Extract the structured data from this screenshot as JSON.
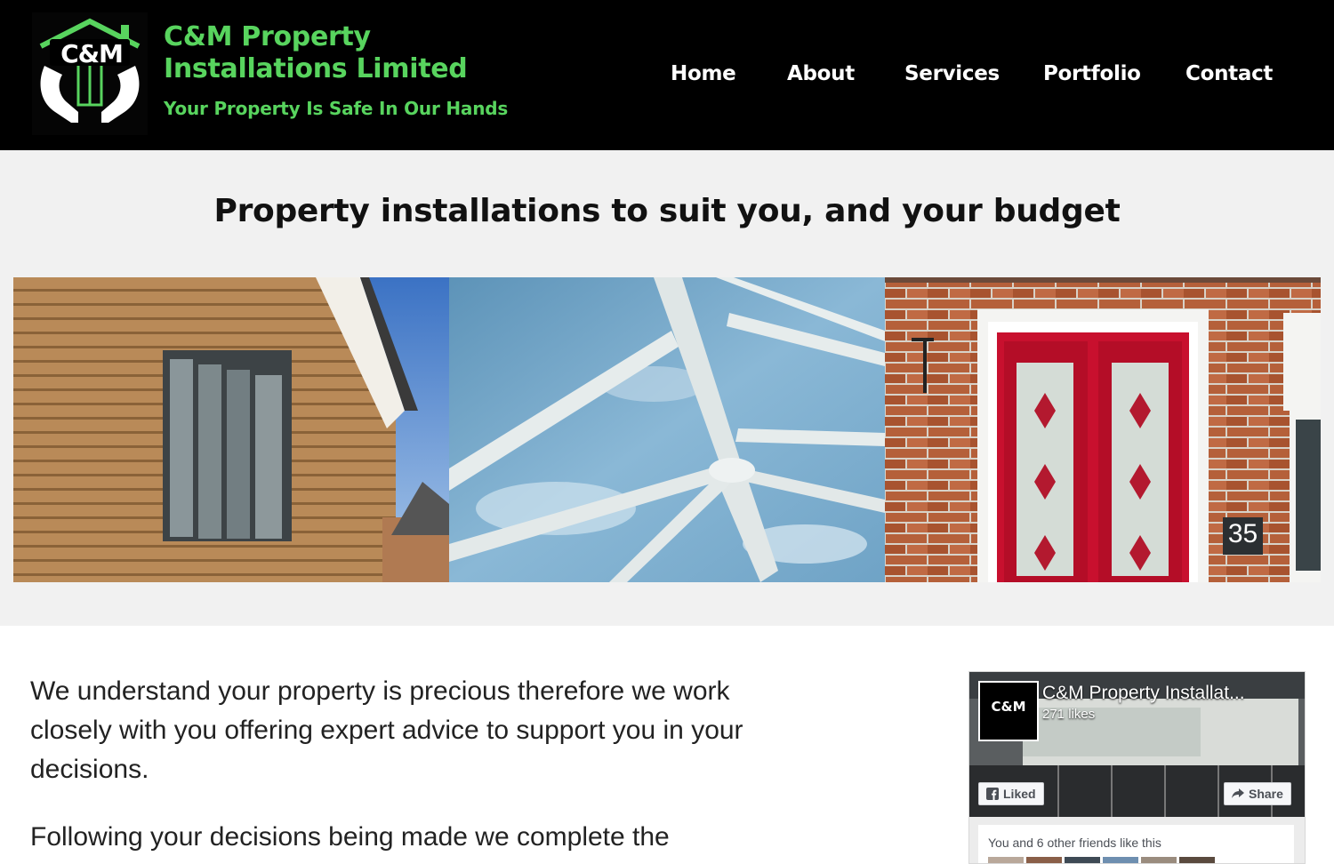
{
  "header": {
    "logo_text": "C&M",
    "brand_line1": "C&M Property",
    "brand_line2": "Installations Limited",
    "tagline": "Your Property Is Safe In Our Hands",
    "nav": [
      "Home",
      "About",
      "Services",
      "Portfolio",
      "Contact"
    ]
  },
  "hero": {
    "heading": "Property installations to suit you, and your budget",
    "door_number": "35"
  },
  "intro": {
    "paragraph1": "We understand your property is precious therefore we work closely with you offering expert advice to support you in your decisions.",
    "paragraph2": "Following your decisions being made we complete the"
  },
  "facebook": {
    "page_title": "C&M Property Installat...",
    "likes": "271 likes",
    "liked_label": "Liked",
    "share_label": "Share",
    "friends_text": "You and 6 other friends like this",
    "avatar_text": "C&M"
  },
  "colors": {
    "brand_green": "#58d45e",
    "header_bg": "#000000",
    "hero_bg": "#f1f1f1",
    "door_red": "#c8102e"
  }
}
